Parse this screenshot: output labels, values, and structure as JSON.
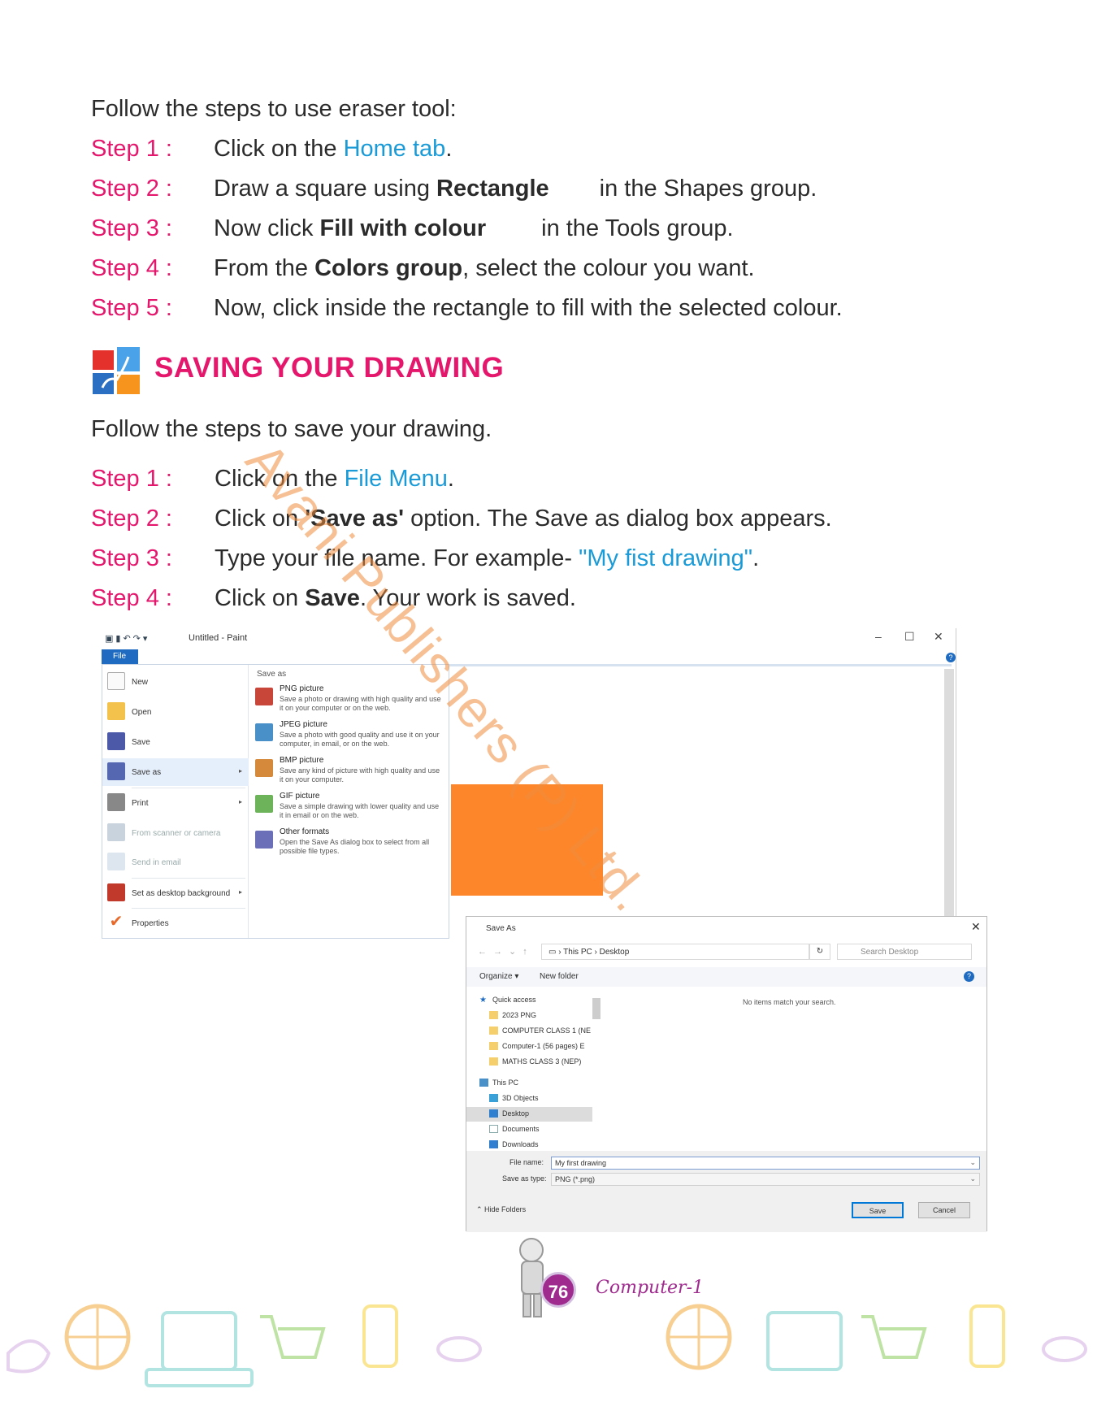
{
  "section1": {
    "intro": "Follow the steps to use  eraser tool:",
    "steps": [
      {
        "label": "Step 1 :",
        "parts": [
          "Click on the ",
          "Home tab",
          "."
        ]
      },
      {
        "label": "Step 2 :",
        "parts": [
          "Draw a square using ",
          "Rectangle",
          "in the Shapes group."
        ]
      },
      {
        "label": "Step 3 :",
        "parts": [
          "Now click ",
          "Fill with colour",
          "in the Tools group."
        ]
      },
      {
        "label": "Step 4 :",
        "parts": [
          "From the ",
          "Colors group",
          ", select the colour you want."
        ]
      },
      {
        "label": "Step 5 :",
        "parts": [
          "Now, click inside the rectangle to fill with the selected colour."
        ]
      }
    ]
  },
  "section2": {
    "heading": "SAVING YOUR DRAWING",
    "intro": "Follow the steps to save your drawing.",
    "steps": [
      {
        "label": "Step 1 :",
        "parts": [
          "Click on the ",
          "File Menu",
          "."
        ]
      },
      {
        "label": "Step 2 :",
        "parts": [
          "Click on ",
          "'Save as'",
          " option. The Save as dialog box appears."
        ]
      },
      {
        "label": "Step 3 :",
        "parts": [
          "Type your file name. For example- ",
          "\"My fist drawing\"",
          "."
        ]
      },
      {
        "label": "Step 4 :",
        "parts": [
          "Click on ",
          "Save",
          ". Your work is saved."
        ]
      }
    ]
  },
  "watermark": "Avani Publishers (P) Ltd.",
  "paint": {
    "title": "Untitled - Paint",
    "file_tab": "File",
    "win_controls": [
      "–",
      "☐",
      "✕"
    ],
    "menu_items": [
      {
        "label": "New"
      },
      {
        "label": "Open"
      },
      {
        "label": "Save"
      },
      {
        "label": "Save as"
      },
      {
        "label": "Print"
      },
      {
        "label": "From scanner or camera"
      },
      {
        "label": "Send in email"
      },
      {
        "label": "Set as desktop background"
      },
      {
        "label": "Properties"
      }
    ],
    "save_as_header": "Save as",
    "save_as_options": [
      {
        "title": "PNG picture",
        "desc": "Save a photo or drawing with high quality and use it on your computer or on the web."
      },
      {
        "title": "JPEG picture",
        "desc": "Save a photo with good quality and use it on your computer, in email, or on the web."
      },
      {
        "title": "BMP picture",
        "desc": "Save any kind of picture with high quality and use it on your computer."
      },
      {
        "title": "GIF picture",
        "desc": "Save a simple drawing with lower quality and use it in email or on the web."
      },
      {
        "title": "Other formats",
        "desc": "Open the Save As dialog box to select from all possible file types."
      }
    ],
    "fill_color": "#fd862a"
  },
  "dialog": {
    "title": "Save As",
    "path": [
      "This PC",
      "Desktop"
    ],
    "search_placeholder": "Search Desktop",
    "organize": "Organize ▾",
    "new_folder": "New folder",
    "nav": [
      {
        "label": "Quick access",
        "type": "star"
      },
      {
        "label": "2023 PNG",
        "type": "folder"
      },
      {
        "label": "COMPUTER CLASS 1 (NE",
        "type": "folder"
      },
      {
        "label": "Computer-1 (56 pages) E",
        "type": "folder"
      },
      {
        "label": "MATHS CLASS 3 (NEP)",
        "type": "folder"
      },
      {
        "label": "This PC",
        "type": "pc"
      },
      {
        "label": "3D Objects",
        "type": "cube"
      },
      {
        "label": "Desktop",
        "type": "desktop"
      },
      {
        "label": "Documents",
        "type": "doc"
      },
      {
        "label": "Downloads",
        "type": "down"
      }
    ],
    "empty_message": "No items match your search.",
    "file_name_label": "File name:",
    "file_name_value": "My first drawing",
    "save_type_label": "Save as type:",
    "save_type_value": "PNG (*.png)",
    "hide_folders": "Hide Folders",
    "save_button": "Save",
    "cancel_button": "Cancel"
  },
  "footer": {
    "page_number": "76",
    "book_title": "Computer-1"
  },
  "colors": {
    "step_label": "#e5176d",
    "link_blue": "#1a9bd7",
    "heading": "#e5176d",
    "footer_purple": "#a02b8f"
  }
}
